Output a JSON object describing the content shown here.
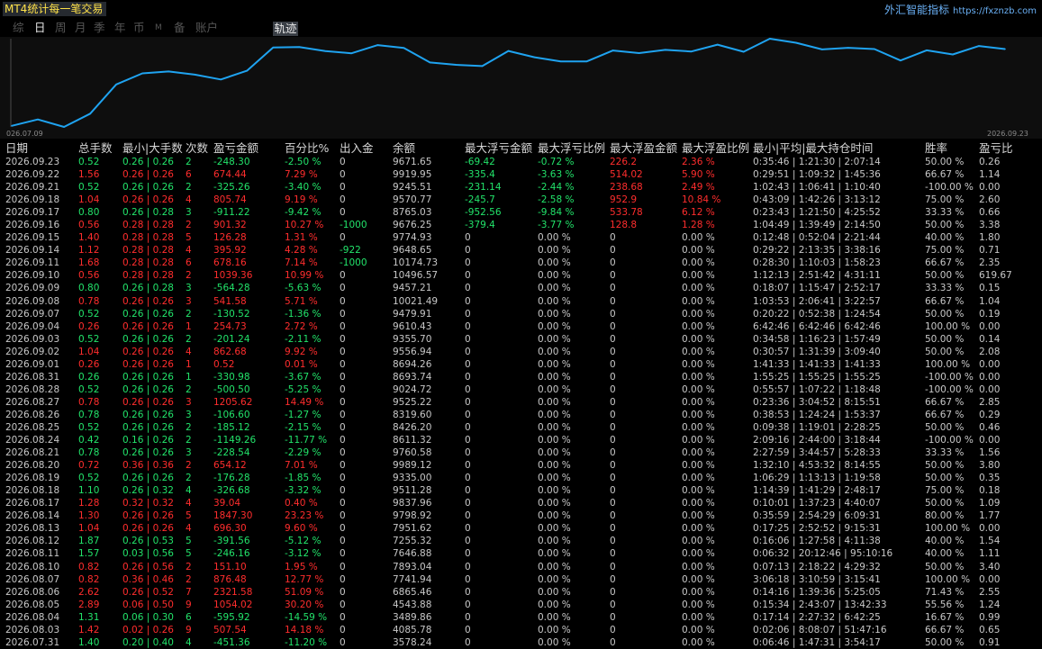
{
  "app_title": "MT4统计每一笔交易",
  "brand": {
    "name": "外汇智能指标",
    "url": "https://fxznzb.com"
  },
  "tabs": [
    {
      "label": "综",
      "active": false
    },
    {
      "label": "日",
      "active": true
    },
    {
      "label": "周",
      "active": false
    },
    {
      "label": "月",
      "active": false
    },
    {
      "label": "季",
      "active": false
    },
    {
      "label": "年",
      "active": false
    },
    {
      "label": "币",
      "active": false
    },
    {
      "label": "M",
      "active": false
    },
    {
      "label": "备",
      "active": false
    },
    {
      "label": "账户",
      "active": false
    }
  ],
  "track_button": "轨迹",
  "chart_data": {
    "type": "line",
    "x_start_label": "026.07.09",
    "x_end_label": "2026.09.23",
    "line_color": "#1fa3f0",
    "grid": false,
    "values": [
      3578.24,
      4085.78,
      3489.86,
      4543.88,
      6865.46,
      7741.94,
      7893.04,
      7646.88,
      7255.32,
      7951.62,
      9798.92,
      9837.96,
      9511.28,
      9335.0,
      9989.12,
      9760.58,
      8611.32,
      8426.2,
      8319.6,
      9525.22,
      9024.72,
      8693.74,
      8694.26,
      9556.94,
      9355.7,
      9610.43,
      9479.91,
      10021.49,
      9457.21,
      10496.57,
      10174.73,
      9648.65,
      9774.93,
      9676.25,
      8765.03,
      9570.77,
      9245.51,
      9919.95,
      9671.65
    ]
  },
  "table": {
    "headers": [
      "日期",
      "总手数",
      "最小|大手数",
      "次数",
      "盈亏金额",
      "百分比%",
      "出入金",
      "余额",
      "最大浮亏金额",
      "最大浮亏比例",
      "最大浮盈金额",
      "最大浮盈比例",
      "最小|平均|最大持仓时间",
      "胜率",
      "盈亏比"
    ],
    "rows": [
      [
        "2026.09.23",
        "0.52",
        "0.26 | 0.26",
        "2",
        "-248.30",
        "-2.50 %",
        "0",
        "9671.65",
        "-69.42",
        "-0.72 %",
        "226.2",
        "2.36 %",
        "0:35:46 | 1:21:30 | 2:07:14",
        "50.00 %",
        "0.26"
      ],
      [
        "2026.09.22",
        "1.56",
        "0.26 | 0.26",
        "6",
        "674.44",
        "7.29 %",
        "0",
        "9919.95",
        "-335.4",
        "-3.63 %",
        "514.02",
        "5.90 %",
        "0:29:51 | 1:09:32 | 1:45:36",
        "66.67 %",
        "1.14"
      ],
      [
        "2026.09.21",
        "0.52",
        "0.26 | 0.26",
        "2",
        "-325.26",
        "-3.40 %",
        "0",
        "9245.51",
        "-231.14",
        "-2.44 %",
        "238.68",
        "2.49 %",
        "1:02:43 | 1:06:41 | 1:10:40",
        "-100.00 %",
        "0.00"
      ],
      [
        "2026.09.18",
        "1.04",
        "0.26 | 0.26",
        "4",
        "805.74",
        "9.19 %",
        "0",
        "9570.77",
        "-245.7",
        "-2.58 %",
        "952.9",
        "10.84 %",
        "0:43:09 | 1:42:26 | 3:13:12",
        "75.00 %",
        "2.60"
      ],
      [
        "2026.09.17",
        "0.80",
        "0.26 | 0.28",
        "3",
        "-911.22",
        "-9.42 %",
        "0",
        "8765.03",
        "-952.56",
        "-9.84 %",
        "533.78",
        "6.12 %",
        "0:23:43 | 1:21:50 | 4:25:52",
        "33.33 %",
        "0.66"
      ],
      [
        "2026.09.16",
        "0.56",
        "0.28 | 0.28",
        "2",
        "901.32",
        "10.27 %",
        "-1000",
        "9676.25",
        "-379.4",
        "-3.77 %",
        "128.8",
        "1.28 %",
        "1:04:49 | 1:39:49 | 2:14:50",
        "50.00 %",
        "3.38"
      ],
      [
        "2026.09.15",
        "1.40",
        "0.28 | 0.28",
        "5",
        "126.28",
        "1.31 %",
        "0",
        "9774.93",
        "0",
        "0.00 %",
        "0",
        "0.00 %",
        "0:12:48 | 0:52:04 | 2:21:44",
        "40.00 %",
        "1.80"
      ],
      [
        "2026.09.14",
        "1.12",
        "0.28 | 0.28",
        "4",
        "395.92",
        "4.28 %",
        "-922",
        "9648.65",
        "0",
        "0.00 %",
        "0",
        "0.00 %",
        "0:29:22 | 2:13:35 | 3:38:16",
        "75.00 %",
        "0.71"
      ],
      [
        "2026.09.11",
        "1.68",
        "0.28 | 0.28",
        "6",
        "678.16",
        "7.14 %",
        "-1000",
        "10174.73",
        "0",
        "0.00 %",
        "0",
        "0.00 %",
        "0:28:30 | 1:10:03 | 1:58:23",
        "66.67 %",
        "2.35"
      ],
      [
        "2026.09.10",
        "0.56",
        "0.28 | 0.28",
        "2",
        "1039.36",
        "10.99 %",
        "0",
        "10496.57",
        "0",
        "0.00 %",
        "0",
        "0.00 %",
        "1:12:13 | 2:51:42 | 4:31:11",
        "50.00 %",
        "619.67"
      ],
      [
        "2026.09.09",
        "0.80",
        "0.26 | 0.28",
        "3",
        "-564.28",
        "-5.63 %",
        "0",
        "9457.21",
        "0",
        "0.00 %",
        "0",
        "0.00 %",
        "0:18:07 | 1:15:47 | 2:52:17",
        "33.33 %",
        "0.15"
      ],
      [
        "2026.09.08",
        "0.78",
        "0.26 | 0.26",
        "3",
        "541.58",
        "5.71 %",
        "0",
        "10021.49",
        "0",
        "0.00 %",
        "0",
        "0.00 %",
        "1:03:53 | 2:06:41 | 3:22:57",
        "66.67 %",
        "1.04"
      ],
      [
        "2026.09.07",
        "0.52",
        "0.26 | 0.26",
        "2",
        "-130.52",
        "-1.36 %",
        "0",
        "9479.91",
        "0",
        "0.00 %",
        "0",
        "0.00 %",
        "0:20:22 | 0:52:38 | 1:24:54",
        "50.00 %",
        "0.19"
      ],
      [
        "2026.09.04",
        "0.26",
        "0.26 | 0.26",
        "1",
        "254.73",
        "2.72 %",
        "0",
        "9610.43",
        "0",
        "0.00 %",
        "0",
        "0.00 %",
        "6:42:46 | 6:42:46 | 6:42:46",
        "100.00 %",
        "0.00"
      ],
      [
        "2026.09.03",
        "0.52",
        "0.26 | 0.26",
        "2",
        "-201.24",
        "-2.11 %",
        "0",
        "9355.70",
        "0",
        "0.00 %",
        "0",
        "0.00 %",
        "0:34:58 | 1:16:23 | 1:57:49",
        "50.00 %",
        "0.14"
      ],
      [
        "2026.09.02",
        "1.04",
        "0.26 | 0.26",
        "4",
        "862.68",
        "9.92 %",
        "0",
        "9556.94",
        "0",
        "0.00 %",
        "0",
        "0.00 %",
        "0:30:57 | 1:31:39 | 3:09:40",
        "50.00 %",
        "2.08"
      ],
      [
        "2026.09.01",
        "0.26",
        "0.26 | 0.26",
        "1",
        "0.52",
        "0.01 %",
        "0",
        "8694.26",
        "0",
        "0.00 %",
        "0",
        "0.00 %",
        "1:41:33 | 1:41:33 | 1:41:33",
        "100.00 %",
        "0.00"
      ],
      [
        "2026.08.31",
        "0.26",
        "0.26 | 0.26",
        "1",
        "-330.98",
        "-3.67 %",
        "0",
        "8693.74",
        "0",
        "0.00 %",
        "0",
        "0.00 %",
        "1:55:25 | 1:55:25 | 1:55:25",
        "-100.00 %",
        "0.00"
      ],
      [
        "2026.08.28",
        "0.52",
        "0.26 | 0.26",
        "2",
        "-500.50",
        "-5.25 %",
        "0",
        "9024.72",
        "0",
        "0.00 %",
        "0",
        "0.00 %",
        "0:55:57 | 1:07:22 | 1:18:48",
        "-100.00 %",
        "0.00"
      ],
      [
        "2026.08.27",
        "0.78",
        "0.26 | 0.26",
        "3",
        "1205.62",
        "14.49 %",
        "0",
        "9525.22",
        "0",
        "0.00 %",
        "0",
        "0.00 %",
        "0:23:36 | 3:04:52 | 8:15:51",
        "66.67 %",
        "2.85"
      ],
      [
        "2026.08.26",
        "0.78",
        "0.26 | 0.26",
        "3",
        "-106.60",
        "-1.27 %",
        "0",
        "8319.60",
        "0",
        "0.00 %",
        "0",
        "0.00 %",
        "0:38:53 | 1:24:24 | 1:53:37",
        "66.67 %",
        "0.29"
      ],
      [
        "2026.08.25",
        "0.52",
        "0.26 | 0.26",
        "2",
        "-185.12",
        "-2.15 %",
        "0",
        "8426.20",
        "0",
        "0.00 %",
        "0",
        "0.00 %",
        "0:09:38 | 1:19:01 | 2:28:25",
        "50.00 %",
        "0.46"
      ],
      [
        "2026.08.24",
        "0.42",
        "0.16 | 0.26",
        "2",
        "-1149.26",
        "-11.77 %",
        "0",
        "8611.32",
        "0",
        "0.00 %",
        "0",
        "0.00 %",
        "2:09:16 | 2:44:00 | 3:18:44",
        "-100.00 %",
        "0.00"
      ],
      [
        "2026.08.21",
        "0.78",
        "0.26 | 0.26",
        "3",
        "-228.54",
        "-2.29 %",
        "0",
        "9760.58",
        "0",
        "0.00 %",
        "0",
        "0.00 %",
        "2:27:59 | 3:44:57 | 5:28:33",
        "33.33 %",
        "1.56"
      ],
      [
        "2026.08.20",
        "0.72",
        "0.36 | 0.36",
        "2",
        "654.12",
        "7.01 %",
        "0",
        "9989.12",
        "0",
        "0.00 %",
        "0",
        "0.00 %",
        "1:32:10 | 4:53:32 | 8:14:55",
        "50.00 %",
        "3.80"
      ],
      [
        "2026.08.19",
        "0.52",
        "0.26 | 0.26",
        "2",
        "-176.28",
        "-1.85 %",
        "0",
        "9335.00",
        "0",
        "0.00 %",
        "0",
        "0.00 %",
        "1:06:29 | 1:13:13 | 1:19:58",
        "50.00 %",
        "0.35"
      ],
      [
        "2026.08.18",
        "1.10",
        "0.26 | 0.32",
        "4",
        "-326.68",
        "-3.32 %",
        "0",
        "9511.28",
        "0",
        "0.00 %",
        "0",
        "0.00 %",
        "1:14:39 | 1:41:29 | 2:48:17",
        "75.00 %",
        "0.18"
      ],
      [
        "2026.08.17",
        "1.28",
        "0.32 | 0.32",
        "4",
        "39.04",
        "0.40 %",
        "0",
        "9837.96",
        "0",
        "0.00 %",
        "0",
        "0.00 %",
        "0:10:01 | 1:37:23 | 4:40:07",
        "50.00 %",
        "1.09"
      ],
      [
        "2026.08.14",
        "1.30",
        "0.26 | 0.26",
        "5",
        "1847.30",
        "23.23 %",
        "0",
        "9798.92",
        "0",
        "0.00 %",
        "0",
        "0.00 %",
        "0:35:59 | 2:54:29 | 6:09:31",
        "80.00 %",
        "1.77"
      ],
      [
        "2026.08.13",
        "1.04",
        "0.26 | 0.26",
        "4",
        "696.30",
        "9.60 %",
        "0",
        "7951.62",
        "0",
        "0.00 %",
        "0",
        "0.00 %",
        "0:17:25 | 2:52:52 | 9:15:31",
        "100.00 %",
        "0.00"
      ],
      [
        "2026.08.12",
        "1.87",
        "0.26 | 0.53",
        "5",
        "-391.56",
        "-5.12 %",
        "0",
        "7255.32",
        "0",
        "0.00 %",
        "0",
        "0.00 %",
        "0:16:06 | 1:27:58 | 4:11:38",
        "40.00 %",
        "1.54"
      ],
      [
        "2026.08.11",
        "1.57",
        "0.03 | 0.56",
        "5",
        "-246.16",
        "-3.12 %",
        "0",
        "7646.88",
        "0",
        "0.00 %",
        "0",
        "0.00 %",
        "0:06:32 | 20:12:46 | 95:10:16",
        "40.00 %",
        "1.11"
      ],
      [
        "2026.08.10",
        "0.82",
        "0.26 | 0.56",
        "2",
        "151.10",
        "1.95 %",
        "0",
        "7893.04",
        "0",
        "0.00 %",
        "0",
        "0.00 %",
        "0:07:13 | 2:18:22 | 4:29:32",
        "50.00 %",
        "3.40"
      ],
      [
        "2026.08.07",
        "0.82",
        "0.36 | 0.46",
        "2",
        "876.48",
        "12.77 %",
        "0",
        "7741.94",
        "0",
        "0.00 %",
        "0",
        "0.00 %",
        "3:06:18 | 3:10:59 | 3:15:41",
        "100.00 %",
        "0.00"
      ],
      [
        "2026.08.06",
        "2.62",
        "0.26 | 0.52",
        "7",
        "2321.58",
        "51.09 %",
        "0",
        "6865.46",
        "0",
        "0.00 %",
        "0",
        "0.00 %",
        "0:14:16 | 1:39:36 | 5:25:05",
        "71.43 %",
        "2.55"
      ],
      [
        "2026.08.05",
        "2.89",
        "0.06 | 0.50",
        "9",
        "1054.02",
        "30.20 %",
        "0",
        "4543.88",
        "0",
        "0.00 %",
        "0",
        "0.00 %",
        "0:15:34 | 2:43:07 | 13:42:33",
        "55.56 %",
        "1.24"
      ],
      [
        "2026.08.04",
        "1.31",
        "0.06 | 0.30",
        "6",
        "-595.92",
        "-14.59 %",
        "0",
        "3489.86",
        "0",
        "0.00 %",
        "0",
        "0.00 %",
        "0:17:14 | 2:27:32 | 6:42:25",
        "16.67 %",
        "0.99"
      ],
      [
        "2026.08.03",
        "1.42",
        "0.02 | 0.26",
        "9",
        "507.54",
        "14.18 %",
        "0",
        "4085.78",
        "0",
        "0.00 %",
        "0",
        "0.00 %",
        "0:02:06 | 8:08:07 | 51:47:16",
        "66.67 %",
        "0.65"
      ],
      [
        "2026.07.31",
        "1.40",
        "0.20 | 0.40",
        "4",
        "-451.36",
        "-11.20 %",
        "0",
        "3578.24",
        "0",
        "0.00 %",
        "0",
        "0.00 %",
        "0:06:46 | 1:47:31 | 3:54:17",
        "50.00 %",
        "0.91"
      ]
    ]
  },
  "colors": {
    "profit": "#ff2d2d",
    "loss": "#22e36a",
    "neutral": "#c8c8c8",
    "line": "#1fa3f0"
  }
}
